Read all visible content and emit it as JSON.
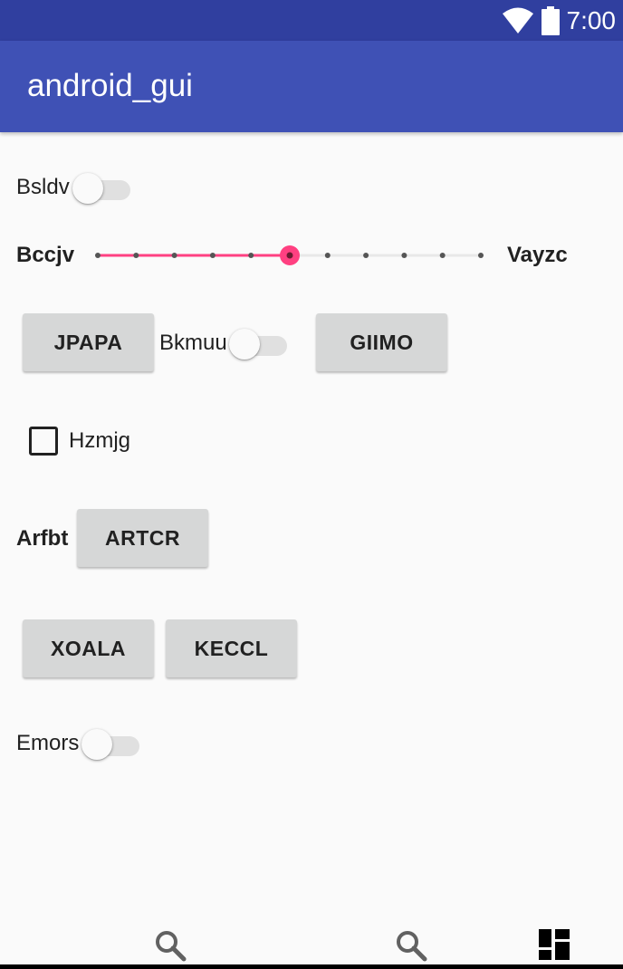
{
  "status_bar": {
    "time": "7:00",
    "icons": [
      "wifi-icon",
      "battery-icon"
    ]
  },
  "app_bar": {
    "title": "android_gui"
  },
  "row1": {
    "switch_label": "Bsldv",
    "switch_on": false
  },
  "row2": {
    "slider_label_left": "Bccjv",
    "slider_label_right": "Vayzc",
    "slider_value_step": 5,
    "slider_steps_total": 10,
    "accent_color": "#ff4081"
  },
  "row3": {
    "button1": "JPAPA",
    "switch_label": "Bkmuu",
    "switch_on": false,
    "button2": "GIIMO"
  },
  "row4": {
    "checkbox_label": "Hzmjg",
    "checked": false
  },
  "row5": {
    "label": "Arfbt",
    "button": "ARTCR"
  },
  "row6": {
    "button1": "XOALA",
    "button2": "KECCL"
  },
  "row7": {
    "switch_label": "Emors",
    "switch_on": false
  },
  "bottom_nav": {
    "icons": [
      "search-icon",
      "search-icon",
      "dashboard-icon"
    ]
  },
  "colors": {
    "status_bar": "#303f9f",
    "app_bar": "#3f51b5",
    "background": "#fafafa",
    "button": "#d6d7d7"
  }
}
